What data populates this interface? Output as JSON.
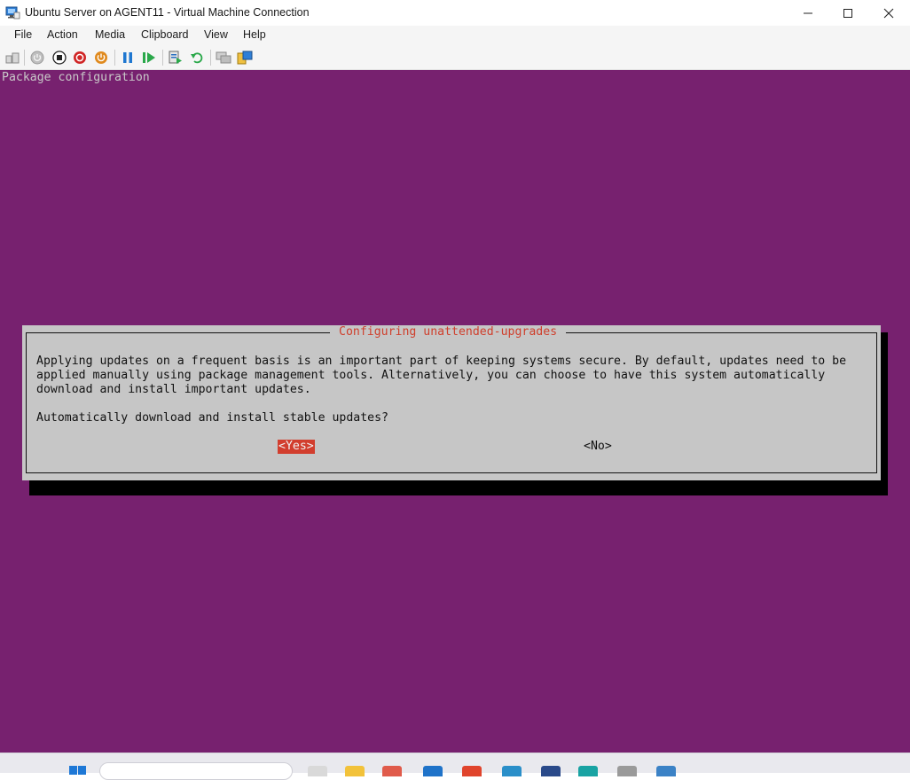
{
  "window": {
    "title": "Ubuntu Server on AGENT11 - Virtual Machine Connection",
    "controls": [
      "minimize",
      "maximize",
      "close"
    ]
  },
  "menu": {
    "items": [
      "File",
      "Action",
      "Media",
      "Clipboard",
      "View",
      "Help"
    ]
  },
  "toolbar": {
    "buttons": [
      "ctrl-alt-del-icon",
      "start-icon",
      "turn-off-icon",
      "shut-down-icon",
      "save-icon",
      "pause-icon",
      "resume-icon",
      "checkpoint-icon",
      "revert-icon",
      "enhanced-session-icon",
      "share-icon"
    ]
  },
  "console": {
    "header": "Package configuration",
    "dialog": {
      "title": "Configuring unattended-upgrades",
      "text": "Applying updates on a frequent basis is an important part of keeping systems secure. By default, updates need to be\napplied manually using package management tools. Alternatively, you can choose to have this system automatically\ndownload and install important updates.",
      "question": "Automatically download and install stable updates?",
      "yes_label": "<Yes>",
      "no_label": "<No>"
    }
  },
  "colors": {
    "console_bg": "#77216f",
    "dialog_bg": "#c6c6c6",
    "dialog_title": "#cf3f2c",
    "selected_button": "#d23e2e"
  }
}
